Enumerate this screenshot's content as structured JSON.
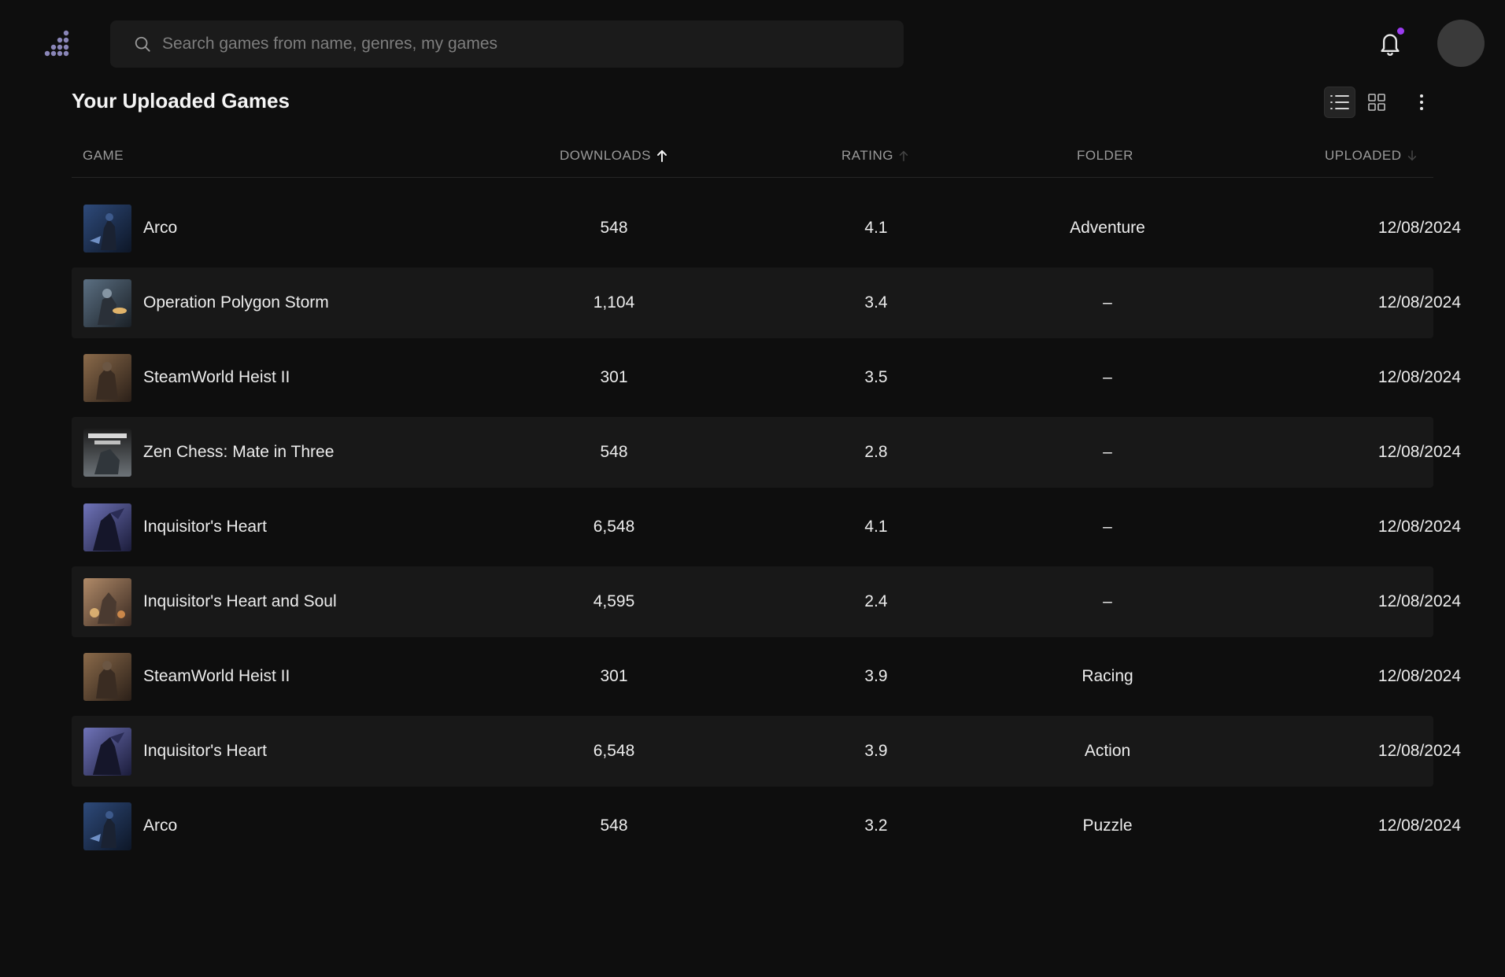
{
  "search": {
    "placeholder": "Search games from name, genres, my games"
  },
  "page": {
    "title": "Your Uploaded Games"
  },
  "icons": {
    "logo": "dots-logo-icon",
    "search": "search-icon",
    "notifications": "bell-icon",
    "list_view": "list-view-icon",
    "grid_view": "grid-view-icon",
    "more": "more-vertical-icon"
  },
  "colors": {
    "accent": "#9b3cf0",
    "background": "#0e0e0e",
    "row_alt": "#181818"
  },
  "table": {
    "columns": {
      "game": "GAME",
      "downloads": "DOWNLOADS",
      "rating": "RATING",
      "folder": "FOLDER",
      "uploaded": "UPLOADED"
    },
    "sort": {
      "column": "downloads",
      "direction": "ascending"
    },
    "rows": [
      {
        "name": "Arco",
        "downloads": "548",
        "rating": "4.1",
        "folder": "Adventure",
        "uploaded": "12/08/2024"
      },
      {
        "name": "Operation Polygon Storm",
        "downloads": "1,104",
        "rating": "3.4",
        "folder": "–",
        "uploaded": "12/08/2024"
      },
      {
        "name": "SteamWorld Heist II",
        "downloads": "301",
        "rating": "3.5",
        "folder": "–",
        "uploaded": "12/08/2024"
      },
      {
        "name": "Zen Chess: Mate in Three",
        "downloads": "548",
        "rating": "2.8",
        "folder": "–",
        "uploaded": "12/08/2024"
      },
      {
        "name": "Inquisitor's Heart",
        "downloads": "6,548",
        "rating": "4.1",
        "folder": "–",
        "uploaded": "12/08/2024"
      },
      {
        "name": "Inquisitor's Heart and Soul",
        "downloads": "4,595",
        "rating": "2.4",
        "folder": "–",
        "uploaded": "12/08/2024"
      },
      {
        "name": "SteamWorld Heist II",
        "downloads": "301",
        "rating": "3.9",
        "folder": "Racing",
        "uploaded": "12/08/2024"
      },
      {
        "name": "Inquisitor's Heart",
        "downloads": "6,548",
        "rating": "3.9",
        "folder": "Action",
        "uploaded": "12/08/2024"
      },
      {
        "name": "Arco",
        "downloads": "548",
        "rating": "3.2",
        "folder": "Puzzle",
        "uploaded": "12/08/2024"
      }
    ]
  }
}
